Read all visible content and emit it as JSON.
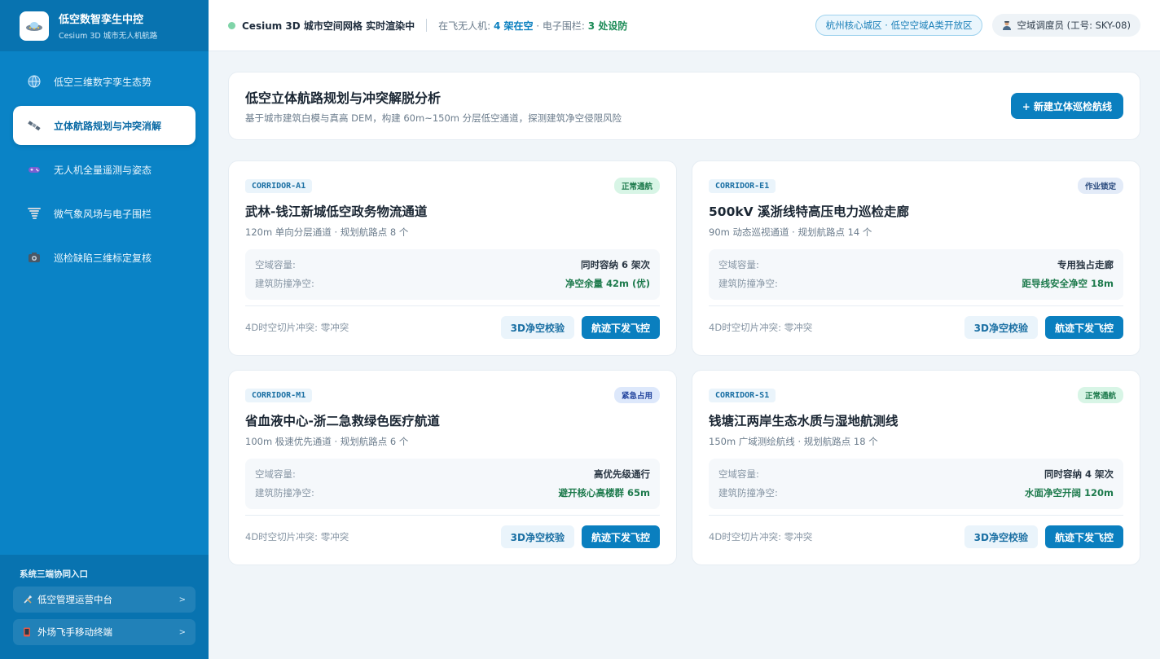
{
  "brand": {
    "title": "低空数智孪生中控",
    "subtitle": "Cesium 3D 城市无人机航路",
    "logo_icon": "ufo-icon"
  },
  "nav": [
    {
      "label": "低空三维数字孪生态势",
      "icon": "globe-icon",
      "active": false
    },
    {
      "label": "立体航路规划与冲突消解",
      "icon": "satellite-icon",
      "active": true
    },
    {
      "label": "无人机全量遥测与姿态",
      "icon": "gamepad-icon",
      "active": false
    },
    {
      "label": "微气象风场与电子围栏",
      "icon": "tornado-icon",
      "active": false
    },
    {
      "label": "巡检缺陷三维标定复核",
      "icon": "camera-icon",
      "active": false
    }
  ],
  "side_footer": {
    "title": "系统三端协同入口",
    "links": [
      {
        "label": "低空管理运营中台",
        "icon": "tools-icon",
        "arrow": ">"
      },
      {
        "label": "外场飞手移动终端",
        "icon": "mobile-icon",
        "arrow": ">"
      }
    ]
  },
  "topbar": {
    "status": "Cesium 3D 城市空间网格 实时渲染中",
    "flying_prefix": "在飞无人机: ",
    "flying_value": "4 架在空",
    "fence_prefix": " · 电子围栏: ",
    "fence_value": "3 处设防",
    "zone": "杭州核心城区 · 低空空域A类开放区",
    "user": "空域调度员 (工号: SKY-08)"
  },
  "header": {
    "title": "低空立体航路规划与冲突解脱分析",
    "description": "基于城市建筑白模与真高 DEM，构建 60m~150m 分层低空通道，探测建筑净空侵限风险",
    "new_button": "+ 新建立体巡检航线"
  },
  "labels": {
    "capacity": "空域容量:",
    "clearance": "建筑防撞净空:",
    "verify_button": "3D净空校验",
    "dispatch_button": "航迹下发飞控"
  },
  "corridors": [
    {
      "code": "CORRIDOR-A1",
      "badge": "正常通航",
      "badge_type": "ok",
      "title": "武林-钱江新城低空政务物流通道",
      "subtitle": "120m 单向分层通道 · 规划航路点 8 个",
      "capacity": "同时容纳 6 架次",
      "clearance": "净空余量 42m (优)",
      "conflict": "4D时空切片冲突: 零冲突"
    },
    {
      "code": "CORRIDOR-E1",
      "badge": "作业锁定",
      "badge_type": "lock",
      "title": "500kV 溪浙线特高压电力巡检走廊",
      "subtitle": "90m 动态巡视通道 · 规划航路点 14 个",
      "capacity": "专用独占走廊",
      "clearance": "距导线安全净空 18m",
      "conflict": "4D时空切片冲突: 零冲突"
    },
    {
      "code": "CORRIDOR-M1",
      "badge": "紧急占用",
      "badge_type": "urgent",
      "title": "省血液中心-浙二急救绿色医疗航道",
      "subtitle": "100m 极速优先通道 · 规划航路点 6 个",
      "capacity": "高优先级通行",
      "clearance": "避开核心高楼群 65m",
      "conflict": "4D时空切片冲突: 零冲突"
    },
    {
      "code": "CORRIDOR-S1",
      "badge": "正常通航",
      "badge_type": "ok",
      "title": "钱塘江两岸生态水质与湿地航测线",
      "subtitle": "150m 广域测绘航线 · 规划航路点 18 个",
      "capacity": "同时容纳 4 架次",
      "clearance": "水面净空开阔 120m",
      "conflict": "4D时空切片冲突: 零冲突"
    }
  ]
}
